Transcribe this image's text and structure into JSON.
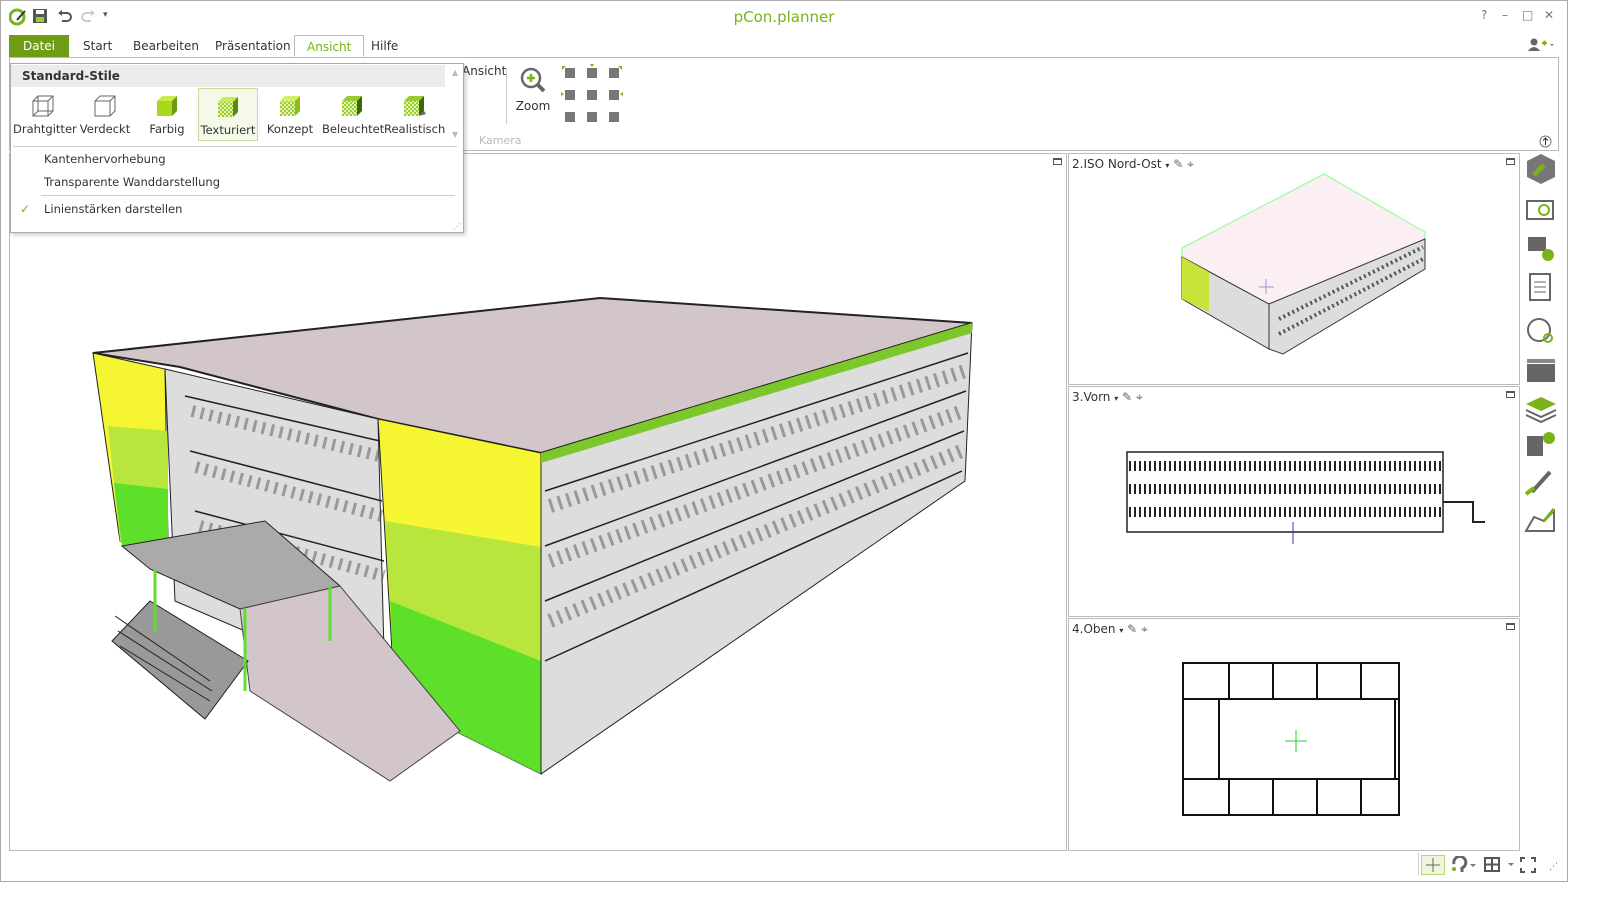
{
  "app": {
    "title": "pCon.planner"
  },
  "quick_access": {
    "save": "save-icon",
    "undo": "undo-icon",
    "redo": "redo-icon",
    "more": "▾"
  },
  "window_controls": {
    "help": "?",
    "minimize": "–",
    "maximize": "□",
    "close": "✕"
  },
  "tabs": [
    {
      "label": "Datei"
    },
    {
      "label": "Start"
    },
    {
      "label": "Bearbeiten"
    },
    {
      "label": "Präsentation"
    },
    {
      "label": "Ansicht",
      "active": true
    },
    {
      "label": "Hilfe"
    }
  ],
  "ribbon": {
    "partial_label": "Ansicht",
    "zoom_label": "Zoom",
    "group_camera": "Kamera"
  },
  "dropdown": {
    "header": "Standard-Stile",
    "styles": [
      {
        "label": "Drahtgitter"
      },
      {
        "label": "Verdeckt"
      },
      {
        "label": "Farbig"
      },
      {
        "label": "Texturiert",
        "selected": true
      },
      {
        "label": "Konzept"
      },
      {
        "label": "Beleuchtet"
      },
      {
        "label": "Realistisch"
      }
    ],
    "options": [
      {
        "label": "Kantenhervorhebung",
        "checked": false
      },
      {
        "label": "Transparente Wanddarstellung",
        "checked": false
      },
      {
        "label": "Linienstärken darstellen",
        "checked": true
      }
    ],
    "check": "✓"
  },
  "viewports": [
    {
      "label": "2.ISO Nord-Ost"
    },
    {
      "label": "3.Vorn"
    },
    {
      "label": "4.Oben"
    }
  ],
  "viewport_menu": {
    "arrow": "▾"
  },
  "colors": {
    "accent": "#7ab317",
    "datei": "#6e9c16",
    "yellow": "#f5f531",
    "lime": "#b8e63c",
    "green": "#5ee02a",
    "roof": "#d6c8cc"
  }
}
